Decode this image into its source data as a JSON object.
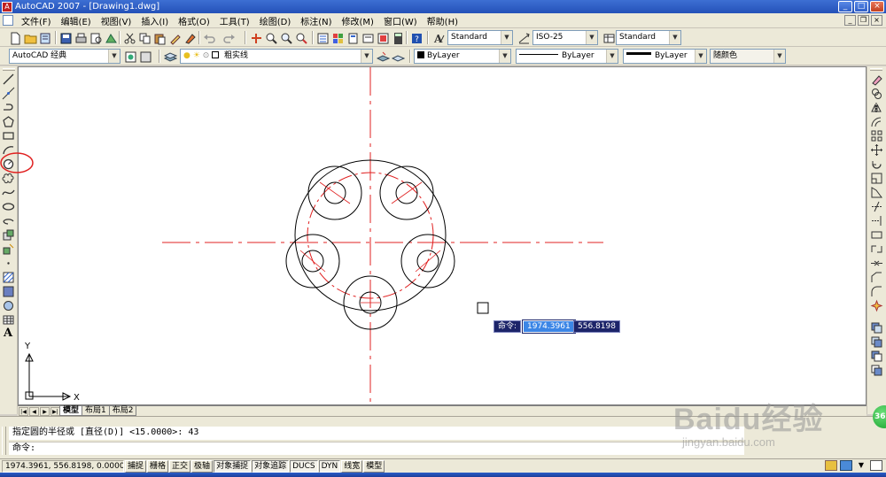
{
  "window": {
    "title": "AutoCAD 2007 - [Drawing1.dwg]",
    "app_icon": "acad-icon",
    "controls": [
      "minimize",
      "maximize",
      "close"
    ]
  },
  "menu": {
    "items": [
      "文件(F)",
      "编辑(E)",
      "视图(V)",
      "插入(I)",
      "格式(O)",
      "工具(T)",
      "绘图(D)",
      "标注(N)",
      "修改(M)",
      "窗口(W)",
      "帮助(H)"
    ]
  },
  "toolbar1": {
    "text_style": "Standard",
    "dim_style": "ISO-25",
    "table_style": "Standard"
  },
  "toolbar2": {
    "workspace": "AutoCAD 经典",
    "layer": "粗实线",
    "color": "ByLayer",
    "linetype": "ByLayer",
    "lineweight": "ByLayer",
    "plot_style": "随颜色"
  },
  "drawing": {
    "ucs_x": "X",
    "ucs_y": "Y",
    "colors": {
      "object": "#000000",
      "centerline": "#e02020",
      "highlight": "#e02020"
    }
  },
  "dynamic_input": {
    "label": "命令:",
    "x_value": "1974.3961",
    "y_value": "556.8198"
  },
  "layout_tabs": [
    "模型",
    "布局1",
    "布局2"
  ],
  "command": {
    "history": "指定圆的半径或 [直径(D)] <15.0000>: 43",
    "prompt": "命令:"
  },
  "status": {
    "coords": "1974.3961, 556.8198, 0.0000",
    "buttons": [
      "捕捉",
      "栅格",
      "正交",
      "极轴",
      "对象捕捉",
      "对象追踪",
      "DUCS",
      "DYN",
      "线宽",
      "模型"
    ]
  },
  "watermark": {
    "main": "Baidu经验",
    "sub": "jingyan.baidu.com",
    "badge": "36"
  }
}
